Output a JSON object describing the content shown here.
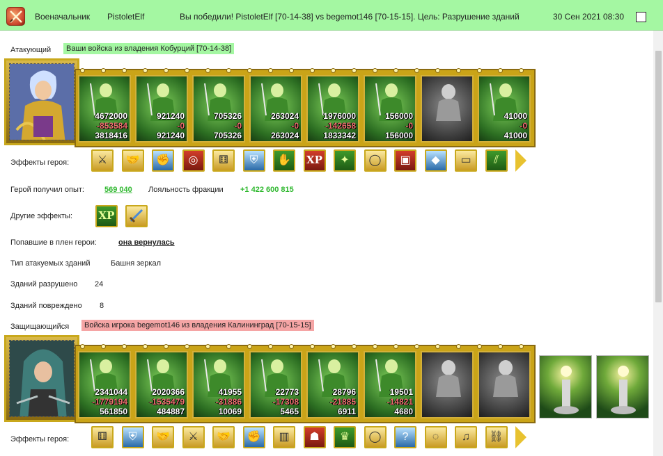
{
  "header": {
    "rank": "Военачальник",
    "player": "PistoletElf",
    "result": "Вы победили! PistoletElf [70-14-38] vs begemot146 [70-15-15]. Цель: Разрушение зданий",
    "datetime": "30 Сен 2021 08:30"
  },
  "attacker": {
    "label": "Атакующий",
    "name": "Ваши войска из владения Кобурций [70-14-38]",
    "units": [
      {
        "top": "4672000",
        "mid": "-853584",
        "bot": "3818416"
      },
      {
        "top": "921240",
        "mid": "-0",
        "bot": "921240"
      },
      {
        "top": "705326",
        "mid": "-0",
        "bot": "705326"
      },
      {
        "top": "263024",
        "mid": "-0",
        "bot": "263024"
      },
      {
        "top": "1976000",
        "mid": "-142658",
        "bot": "1833342"
      },
      {
        "top": "156000",
        "mid": "-0",
        "bot": "156000"
      },
      {
        "top": "",
        "mid": "",
        "bot": ""
      },
      {
        "top": "41000",
        "mid": "-0",
        "bot": "41000"
      }
    ],
    "effects_label": "Эффекты героя:",
    "effects": [
      "sword-icon",
      "handshake-icon",
      "fist-icon",
      "drum-icon",
      "dice-icon",
      "shield-icon",
      "hand-shield-icon",
      "xp-icon",
      "xp-book-icon",
      "ring-icon",
      "armor-icon",
      "crystal-icon",
      "bracer-icon",
      "boots-icon"
    ],
    "xp_label": "Герой получил опыт:",
    "xp_value": "569 040",
    "loyalty_label": "Лояльность фракции",
    "loyalty_value": "+1 422 600 815",
    "other_label": "Другие эффекты:",
    "other_effects": [
      "XP",
      "sword"
    ],
    "captured_label": "Попавшие в плен герои:",
    "captured_value": "она вернулась",
    "building_type_label": "Тип атакуемых зданий",
    "building_type": "Башня зеркал",
    "destroyed_label": "Зданий разрушено",
    "destroyed": "24",
    "damaged_label": "Зданий повреждено",
    "damaged": "8"
  },
  "defender": {
    "label": "Защищающийся",
    "name": "Войска игрока begemot146 из владения Калининград [70-15-15]",
    "units": [
      {
        "top": "2341044",
        "mid": "-1779194",
        "bot": "561850"
      },
      {
        "top": "2020366",
        "mid": "-1535479",
        "bot": "484887"
      },
      {
        "top": "41955",
        "mid": "-31886",
        "bot": "10069"
      },
      {
        "top": "22773",
        "mid": "-17308",
        "bot": "5465"
      },
      {
        "top": "28796",
        "mid": "-21885",
        "bot": "6911"
      },
      {
        "top": "19501",
        "mid": "-14821",
        "bot": "4680"
      },
      {
        "top": "",
        "mid": "",
        "bot": ""
      },
      {
        "top": "",
        "mid": "",
        "bot": ""
      }
    ],
    "effects_label": "Эффекты героя:",
    "effects": [
      "dice-icon",
      "shield-icon",
      "handshake-icon",
      "sword-icon",
      "handshake-icon",
      "fist-icon",
      "barrel-icon",
      "helmet-icon",
      "crown-icon",
      "ring-icon",
      "question-icon",
      "bracelet-icon",
      "harp-icon",
      "chain-icon"
    ]
  },
  "colors": {
    "header_bg": "#a4f7a2",
    "attacker_highlight": "#a4f7a2",
    "defender_highlight": "#f5a5a5",
    "positive": "#2fb82f",
    "loss": "#f07070"
  }
}
